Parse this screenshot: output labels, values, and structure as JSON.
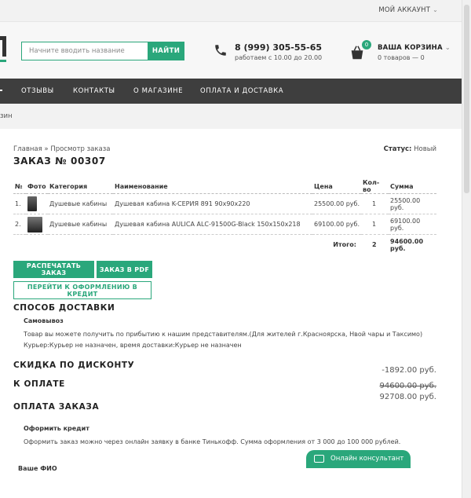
{
  "topbar": {
    "account_label": "МОЙ АККАУНТ"
  },
  "search": {
    "placeholder": "Начните вводить название",
    "button_label": "НАЙТИ"
  },
  "contact": {
    "phone": "8 (999) 305-55-65",
    "hours": "работаем с 10.00 до 20.00"
  },
  "cart": {
    "badge": "0",
    "title": "ВАША КОРЗИНА",
    "summary": "0 товаров — 0"
  },
  "nav": {
    "items": [
      "ОТЗЫВЫ",
      "КОНТАКТЫ",
      "О МАГАЗИНЕ",
      "ОПЛАТА И ДОСТАВКА"
    ]
  },
  "breadcrumb_bar": {
    "text": "зин"
  },
  "order": {
    "breadcrumb_home": "Главная",
    "breadcrumb_sep": " » ",
    "breadcrumb_current": "Просмотр заказа",
    "status_label": "Статус:",
    "status_value": "Новый",
    "title": "ЗАКАЗ № 00307"
  },
  "table": {
    "headers": [
      "№",
      "Фото",
      "Категория",
      "Наименование",
      "Цена",
      "Кол-во",
      "Сумма"
    ],
    "rows": [
      {
        "num": "1.",
        "category": "Душевые кабины",
        "name": "Душевая кабина K-СЕРИЯ 891 90x90x220",
        "price": "25500.00 руб.",
        "qty": "1",
        "sum": "25500.00 руб."
      },
      {
        "num": "2.",
        "category": "Душевые кабины",
        "name": "Душевая кабина AULICA ALC-91500G-Black 150x150x218",
        "price": "69100.00 руб.",
        "qty": "1",
        "sum": "69100.00 руб."
      }
    ],
    "total_label": "Итого:",
    "total_qty": "2",
    "total_sum": "94600.00 руб."
  },
  "buttons": {
    "print": "РАСПЕЧАТАТЬ ЗАКАЗ",
    "pdf": "ЗАКАЗ В PDF",
    "credit": "ПЕРЕЙТИ К ОФОРМЛЕНИЮ В КРЕДИТ"
  },
  "delivery": {
    "heading": "СПОСОБ ДОСТАВКИ",
    "method": "Самовывоз",
    "desc": "Товар вы можете получить по прибытию к нашим представителям.(Для жителей г.Красноярска, Нвой чары и Таксимо)",
    "courier": "Курьер:Курьер не назначен, время доставки:Курьер не назначен"
  },
  "discount": {
    "heading": "СКИДКА ПО ДИСКОНТУ",
    "value": "-1892.00 руб."
  },
  "to_pay": {
    "heading": "К ОПЛАТЕ",
    "old_value": "94600.00 руб.",
    "new_value": "92708.00 руб."
  },
  "payment": {
    "heading": "ОПЛАТА ЗАКАЗА",
    "credit_title": "Оформить кредит",
    "credit_desc": "Оформить заказ можно через онлайн заявку в банке Тинькофф. Сумма оформления от 3 000 до 100 000 рублей.",
    "fio_label": "Ваше ФИО"
  },
  "consultant": {
    "label": "Онлайн консультант"
  },
  "colors": {
    "accent": "#2aa77b",
    "nav_bg": "#3e3e3e",
    "text": "#333333"
  }
}
